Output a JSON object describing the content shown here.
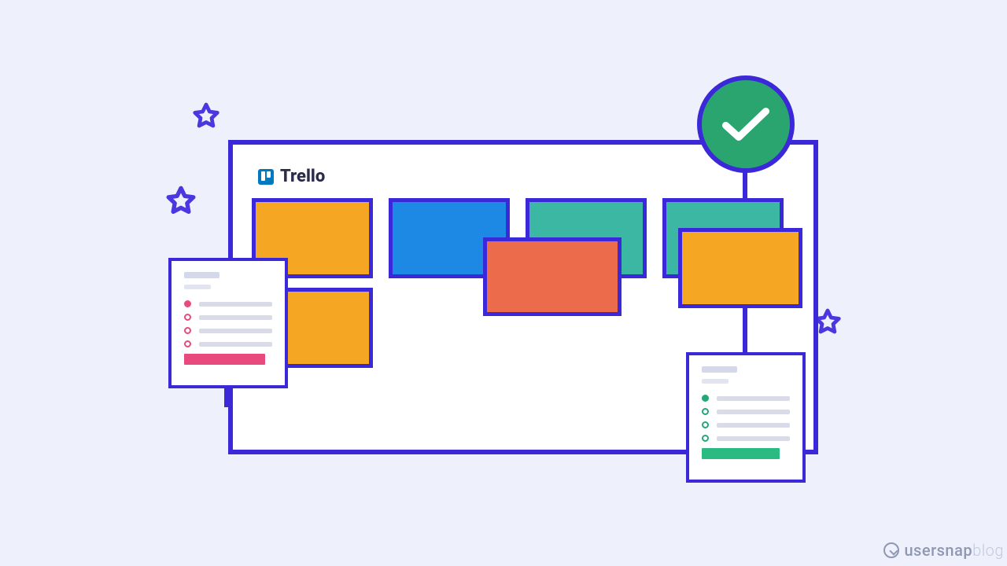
{
  "app": {
    "title": "Trello"
  },
  "badge": {
    "status": "checkmark"
  },
  "cards": {
    "col1_top": {
      "color": "orange"
    },
    "col1_bot": {
      "color": "orange"
    },
    "col2": {
      "color": "blue"
    },
    "col3": {
      "color": "teal"
    },
    "floating": {
      "color": "red-orange"
    },
    "col4": {
      "color": "teal"
    },
    "col4_front": {
      "color": "orange"
    }
  },
  "checklists": {
    "left": {
      "accent": "pink",
      "items": 4
    },
    "right": {
      "accent": "green",
      "items": 4
    }
  },
  "watermark": {
    "brand": "usersnap",
    "suffix": "blog"
  }
}
